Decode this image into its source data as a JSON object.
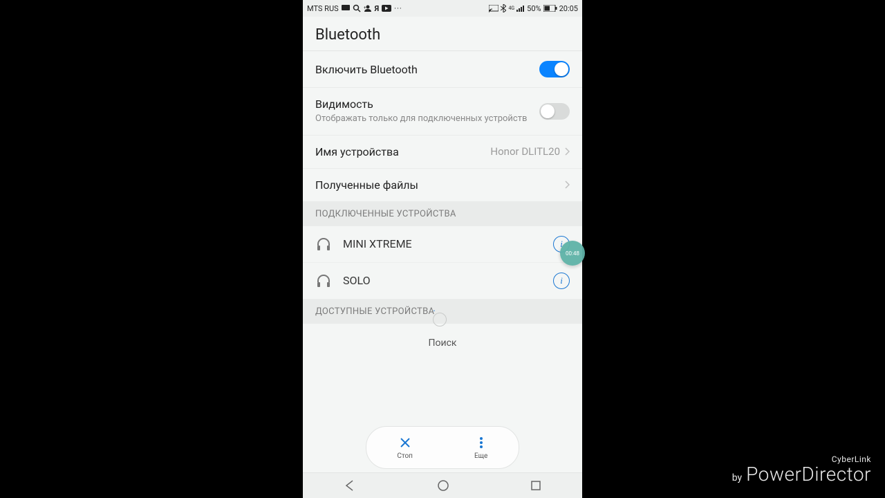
{
  "status": {
    "carrier": "MTS RUS",
    "battery_pct": "50%",
    "time": "20:05"
  },
  "title": "Bluetooth",
  "rows": {
    "enable": {
      "label": "Включить Bluetooth",
      "on": true
    },
    "visibility": {
      "label": "Видимость",
      "sub": "Отображать только для подключенных устройств",
      "on": false
    },
    "device_name": {
      "label": "Имя устройства",
      "value": "Honor DLITL20"
    },
    "received": {
      "label": "Полученные файлы"
    }
  },
  "sections": {
    "connected": "ПОДКЛЮЧЕННЫЕ УСТРОЙСТВА",
    "available": "ДОСТУПНЫЕ УСТРОЙСТВА"
  },
  "connected_devices": [
    {
      "name": "MINI XTREME"
    },
    {
      "name": "SOLO"
    }
  ],
  "searching": "Поиск",
  "rec_badge": "00:48",
  "pill": {
    "stop": "Стоп",
    "more": "Еще"
  },
  "watermark": {
    "brand_small": "CyberLink",
    "by": "by",
    "brand_big": "PowerDirector"
  }
}
